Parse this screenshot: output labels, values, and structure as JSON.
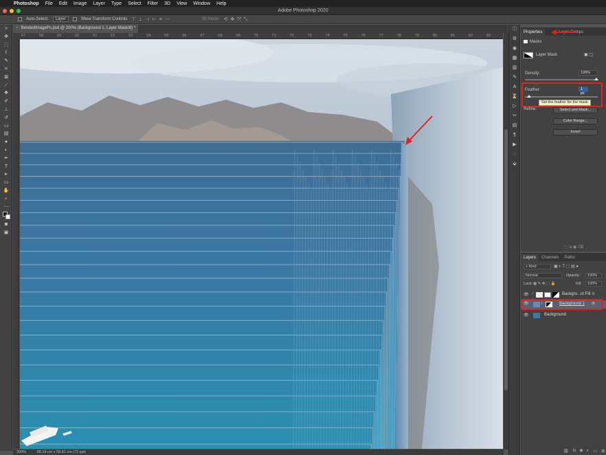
{
  "menubar": {
    "apple": "",
    "app": "Photoshop",
    "items": [
      "File",
      "Edit",
      "Image",
      "Layer",
      "Type",
      "Select",
      "Filter",
      "3D",
      "View",
      "Window",
      "Help"
    ]
  },
  "window": {
    "title": "Adobe Photoshop 2020",
    "traffic_colors": [
      "#ff5f57",
      "#febc2e",
      "#28c840"
    ]
  },
  "options": {
    "auto_select_label": "Auto-Select:",
    "auto_select_value": "Layer",
    "transform_label": "Show Transform Controls",
    "mode_label": "3D Mode:"
  },
  "document": {
    "tab_title": "BendedImagePs.psd @ 200% (Background 1, Layer Mask/8) *",
    "close_glyph": "×"
  },
  "ruler": {
    "ticks": [
      "57",
      "58",
      "59",
      "60",
      "61",
      "62",
      "63",
      "64",
      "65",
      "66",
      "67",
      "68",
      "69",
      "70",
      "71",
      "72",
      "73",
      "74",
      "75",
      "76",
      "77",
      "78",
      "79",
      "80",
      "81",
      "82",
      "83"
    ]
  },
  "status": {
    "zoom": "200%",
    "doc_size": "88.19 cm x 58.81 cm (72 ppi)"
  },
  "properties": {
    "tabs": [
      "Properties",
      "Layer Comps"
    ],
    "masks_label": "Masks",
    "layer_mask_label": "Layer Mask",
    "density_label": "Density:",
    "density_value": "100%",
    "feather_label": "Feather:",
    "feather_value": "1 px",
    "tooltip": "Set the feather for the mask",
    "refine_label": "Refine:",
    "buttons": [
      "Select and Mask...",
      "Color Range...",
      "Invert"
    ]
  },
  "layers": {
    "tabs": [
      "Layers",
      "Channels",
      "Paths"
    ],
    "kind_label": "Kind",
    "blend_mode": "Normal",
    "opacity_label": "Opacity:",
    "opacity_value": "100%",
    "lock_label": "Lock:",
    "fill_label": "Fill:",
    "fill_value": "100%",
    "rows": [
      "Backgro...nt Fill",
      "Background 1",
      "Background"
    ]
  },
  "colors": {
    "highlight": "#e0231c",
    "selected_row": "#5a6270",
    "ocean": "#2f6f9a"
  }
}
